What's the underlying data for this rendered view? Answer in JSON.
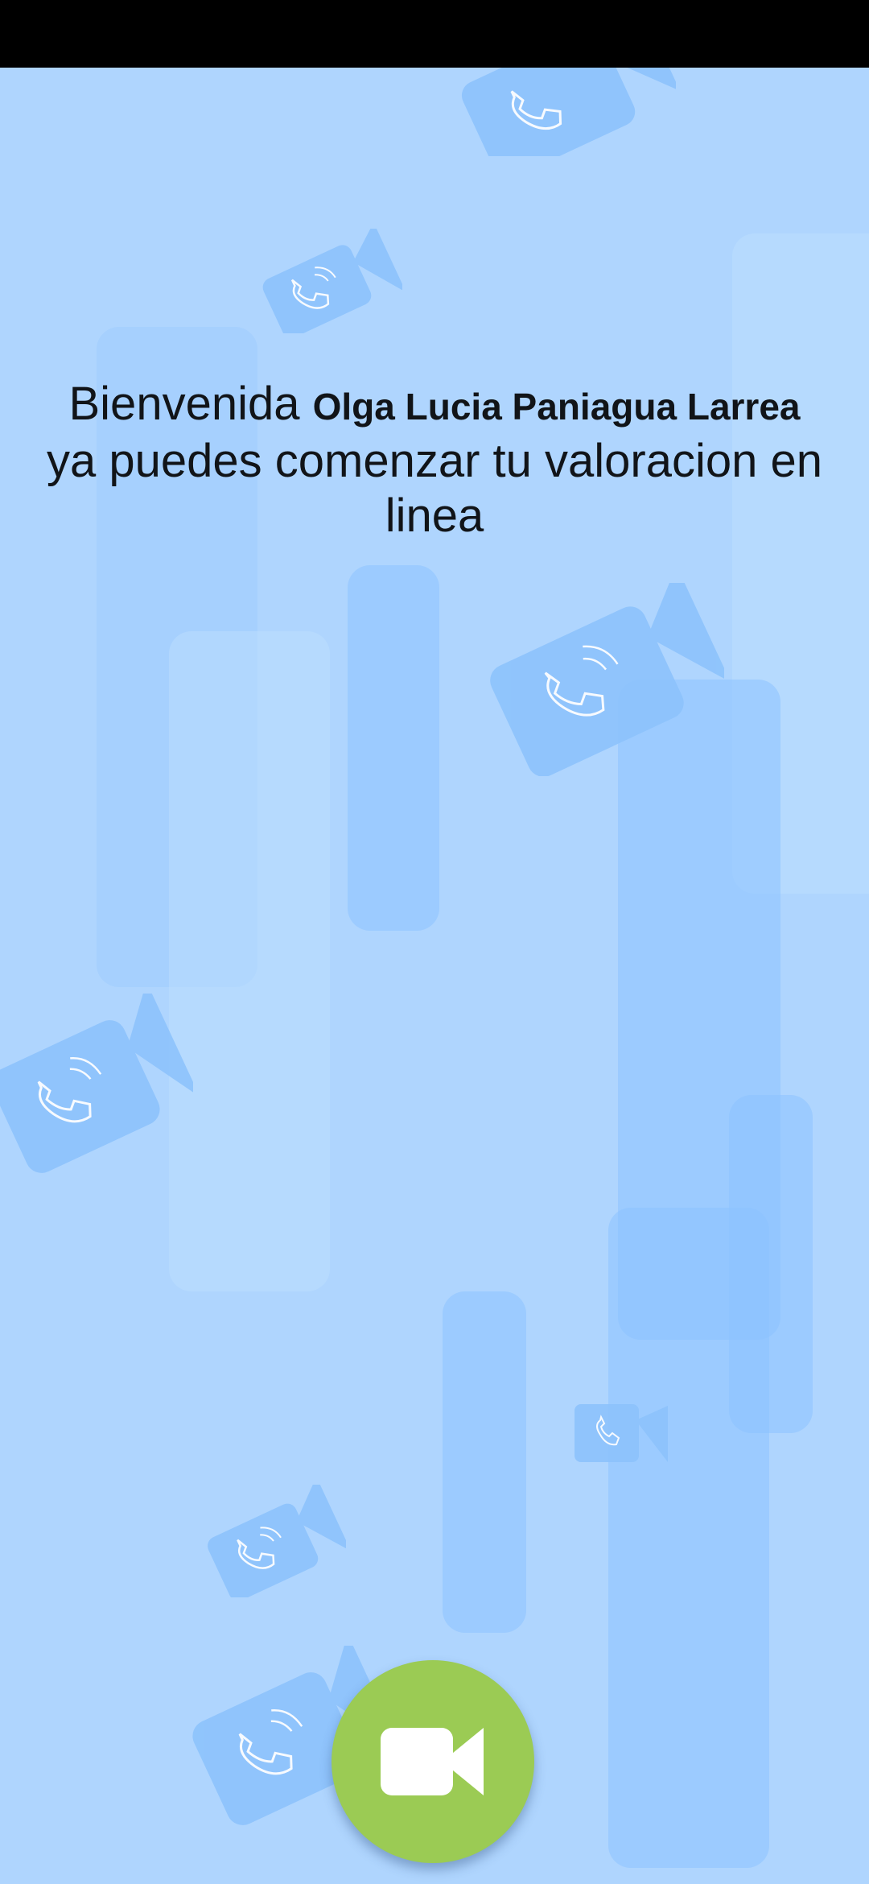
{
  "welcome": {
    "greeting": "Bienvenida",
    "user_name": "Olga Lucia Paniagua Larrea",
    "message": "ya puedes comenzar tu valoracion en linea"
  },
  "colors": {
    "background": "#afd5fe",
    "status_bar": "#000000",
    "call_button": "#9bcb54",
    "call_icon": "#ffffff"
  },
  "icons": {
    "call_button": "video-camera-icon",
    "background_pattern": "video-call-icon"
  }
}
